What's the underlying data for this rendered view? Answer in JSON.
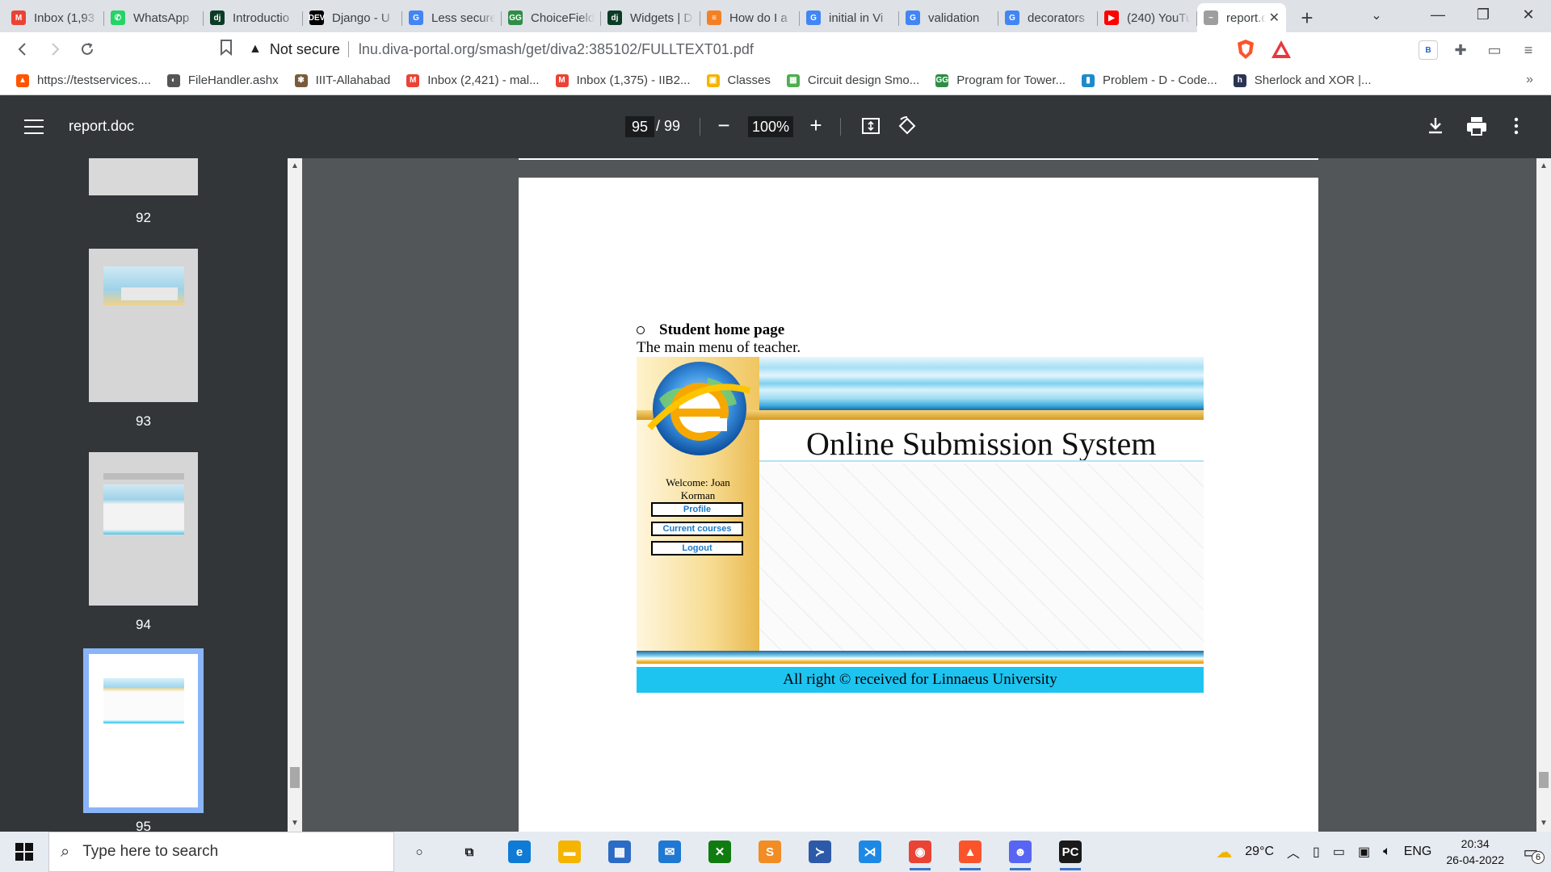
{
  "browser": {
    "tabs": [
      {
        "title": "Inbox (1,93",
        "icon": "gmail-icon",
        "color": "#ea4335",
        "glyph": "M"
      },
      {
        "title": "WhatsApp",
        "icon": "whatsapp-icon",
        "color": "#25d366",
        "glyph": "✆"
      },
      {
        "title": "Introductio",
        "icon": "django-icon",
        "color": "#0c3c26",
        "glyph": "dj"
      },
      {
        "title": "Django - U",
        "icon": "dev-icon",
        "color": "#000000",
        "glyph": "DEV"
      },
      {
        "title": "Less secure",
        "icon": "google-icon",
        "color": "#4285f4",
        "glyph": "G"
      },
      {
        "title": "ChoiceField",
        "icon": "geeksforgeeks-icon",
        "color": "#2f8d46",
        "glyph": "GG"
      },
      {
        "title": "Widgets | D",
        "icon": "django-icon",
        "color": "#0c3c26",
        "glyph": "dj"
      },
      {
        "title": "How do I a",
        "icon": "stackoverflow-icon",
        "color": "#f48024",
        "glyph": "≡"
      },
      {
        "title": "initial in Vi",
        "icon": "google-icon",
        "color": "#4285f4",
        "glyph": "G"
      },
      {
        "title": "validation",
        "icon": "google-icon",
        "color": "#4285f4",
        "glyph": "G"
      },
      {
        "title": "decorators",
        "icon": "google-icon",
        "color": "#4285f4",
        "glyph": "G"
      },
      {
        "title": "(240) YouTu",
        "icon": "youtube-icon",
        "color": "#ff0000",
        "glyph": "▶"
      },
      {
        "title": "report.d",
        "icon": "pdf-icon",
        "color": "#9e9e9e",
        "glyph": "~",
        "active": true
      }
    ],
    "address": {
      "security": "Not secure",
      "url": "lnu.diva-portal.org/smash/get/diva2:385102/FULLTEXT01.pdf"
    },
    "bookmarks": [
      {
        "label": "https://testservices....",
        "icon": "brave-icon",
        "color": "#ff5500",
        "glyph": "▲"
      },
      {
        "label": "FileHandler.ashx",
        "icon": "globe-icon",
        "color": "#555555",
        "glyph": "◐"
      },
      {
        "label": "IIIT-Allahabad",
        "icon": "iiit-icon",
        "color": "#7a5c3a",
        "glyph": "✾"
      },
      {
        "label": "Inbox (2,421) - mal...",
        "icon": "gmail-icon",
        "color": "#ea4335",
        "glyph": "M"
      },
      {
        "label": "Inbox (1,375) - IIB2...",
        "icon": "gmail-icon",
        "color": "#ea4335",
        "glyph": "M"
      },
      {
        "label": "Classes",
        "icon": "classroom-icon",
        "color": "#f4b400",
        "glyph": "▣"
      },
      {
        "label": "Circuit design Smo...",
        "icon": "circuit-icon",
        "color": "#4caf50",
        "glyph": "▦"
      },
      {
        "label": "Program for Tower...",
        "icon": "geeksforgeeks-icon",
        "color": "#2f8d46",
        "glyph": "GG"
      },
      {
        "label": "Problem - D - Code...",
        "icon": "codeforces-icon",
        "color": "#1f8acb",
        "glyph": "▮"
      },
      {
        "label": "Sherlock and XOR |...",
        "icon": "hackerearth-icon",
        "color": "#2c3454",
        "glyph": "h"
      }
    ]
  },
  "viewer": {
    "title": "report.doc",
    "page_current": "95",
    "page_total": "/ 99",
    "zoom": "100%",
    "thumbnails": [
      {
        "label": "92"
      },
      {
        "label": "93"
      },
      {
        "label": "94"
      },
      {
        "label": "95"
      }
    ]
  },
  "page": {
    "bullet_heading": "Student home page",
    "intro": "The main menu of teacher.",
    "embedded_app": {
      "title": "Online Submission System",
      "welcome": "Welcome: Joan Korman",
      "buttons": [
        "Profile",
        "Current courses",
        "Logout"
      ],
      "footer": "All right © received for Linnaeus University"
    }
  },
  "taskbar": {
    "search_placeholder": "Type here to search",
    "apps": [
      {
        "name": "cortana-icon",
        "glyph": "○",
        "color": "#e6ebf1"
      },
      {
        "name": "task-view-icon",
        "glyph": "⧉",
        "color": "#e6ebf1"
      },
      {
        "name": "edge-icon",
        "glyph": "e",
        "color": "#0f7bd5"
      },
      {
        "name": "file-explorer-icon",
        "glyph": "▬",
        "color": "#f5b400"
      },
      {
        "name": "store-icon",
        "glyph": "▦",
        "color": "#2b6cc4"
      },
      {
        "name": "mail-icon",
        "glyph": "✉",
        "color": "#1f78d1"
      },
      {
        "name": "xbox-icon",
        "glyph": "✕",
        "color": "#107c10"
      },
      {
        "name": "sublime-icon",
        "glyph": "S",
        "color": "#f28c24"
      },
      {
        "name": "powershell-icon",
        "glyph": "≻",
        "color": "#2d5aa8"
      },
      {
        "name": "vscode-icon",
        "glyph": "⋊",
        "color": "#1e88e5"
      },
      {
        "name": "chrome-icon",
        "glyph": "◉",
        "color": "#ea4335",
        "running": true
      },
      {
        "name": "brave-icon",
        "glyph": "▲",
        "color": "#fb542b",
        "running": true
      },
      {
        "name": "discord-icon",
        "glyph": "☻",
        "color": "#5865f2",
        "running": true
      },
      {
        "name": "pycharm-icon",
        "glyph": "PC",
        "color": "#1a1a1a",
        "running": true
      }
    ],
    "weather": "29°C",
    "language": "ENG",
    "time": "20:34",
    "date": "26-04-2022",
    "notifications": "6"
  },
  "colors": {
    "viewer_bg": "#525659",
    "viewer_toolbar": "#323639",
    "selection": "#8ab4f8",
    "footer_cyan": "#1ec4f0"
  }
}
